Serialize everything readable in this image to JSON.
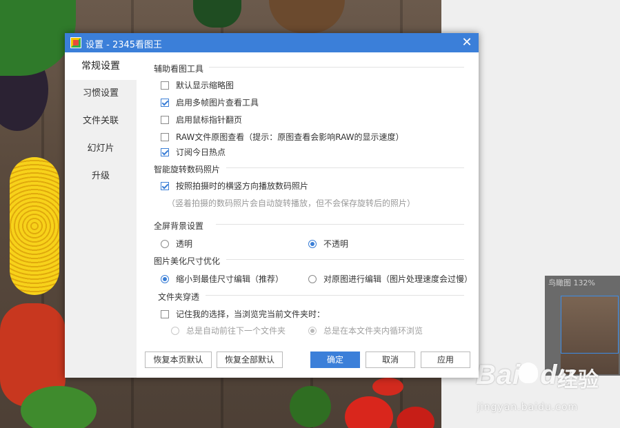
{
  "dialog": {
    "title": "设置 - 2345看图王",
    "close_glyph": "✕"
  },
  "sidebar": {
    "items": [
      {
        "label": "常规设置",
        "active": true
      },
      {
        "label": "习惯设置"
      },
      {
        "label": "文件关联"
      },
      {
        "label": "幻灯片"
      },
      {
        "label": "升级"
      }
    ]
  },
  "sections": {
    "aux_tools": {
      "title": "辅助看图工具",
      "options": [
        {
          "label": "默认显示缩略图",
          "checked": false
        },
        {
          "label": "启用多帧图片查看工具",
          "checked": true
        },
        {
          "label": "启用鼠标指针翻页",
          "checked": false
        },
        {
          "label": "RAW文件原图查看（提示：原图查看会影响RAW的显示速度）",
          "checked": false
        },
        {
          "label": "订阅今日热点",
          "checked": true
        }
      ]
    },
    "rotate": {
      "title": "智能旋转数码照片",
      "option": {
        "label": "按照拍摄时的横竖方向播放数码照片",
        "checked": true
      },
      "hint": "（竖着拍摄的数码照片会自动旋转播放，但不会保存旋转后的照片）"
    },
    "fullscreen_bg": {
      "title": "全屏背景设置",
      "options": [
        {
          "label": "透明",
          "selected": false
        },
        {
          "label": "不透明",
          "selected": true
        }
      ]
    },
    "beautify": {
      "title": "图片美化尺寸优化",
      "options": [
        {
          "label": "缩小到最佳尺寸编辑（推荐）",
          "selected": true
        },
        {
          "label": "对原图进行编辑（图片处理速度会过慢）",
          "selected": false
        }
      ]
    },
    "folder": {
      "title": "文件夹穿透",
      "option": {
        "label": "记住我的选择，当浏览完当前文件夹时：",
        "checked": false
      },
      "sub_options": [
        {
          "label": "总是自动前往下一个文件夹",
          "selected": false
        },
        {
          "label": "总是在本文件夹内循环浏览",
          "selected": true
        }
      ]
    }
  },
  "buttons": {
    "restore_page": "恢复本页默认",
    "restore_all": "恢复全部默认",
    "ok": "确定",
    "cancel": "取消",
    "apply": "应用"
  },
  "navigator": {
    "title": "鸟瞰图 132%"
  },
  "watermark": {
    "logo": "Bai",
    "logo_suffix": "du",
    "cn": "经验",
    "url": "jingyan.baidu.com"
  },
  "colors": {
    "accent": "#3b7fd9",
    "titlebar": "#3b7fd9"
  }
}
